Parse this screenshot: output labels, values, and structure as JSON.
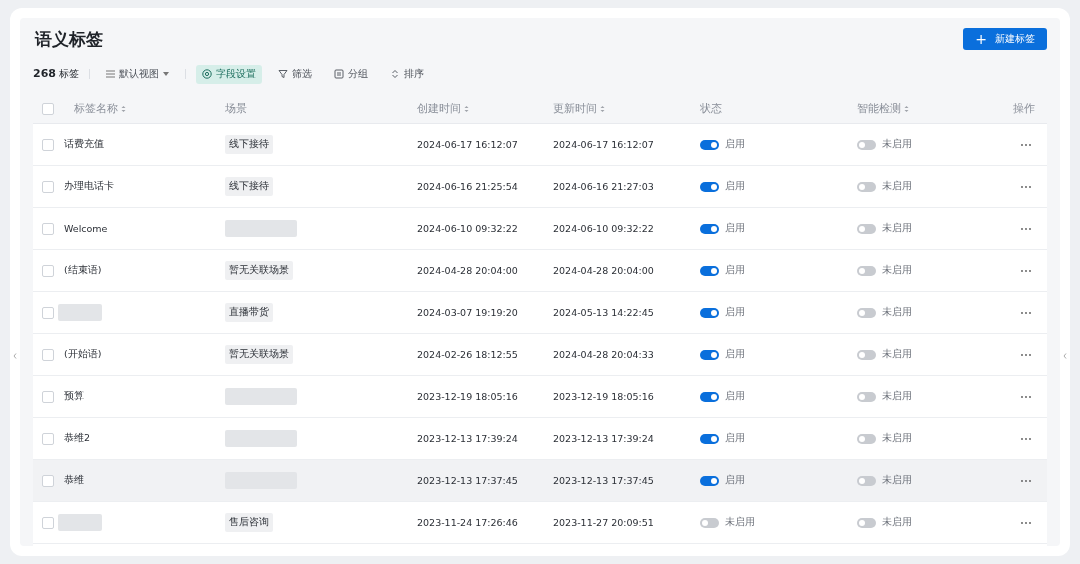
{
  "title": "语义标签",
  "new_button": {
    "icon": "+",
    "label": "新建标签"
  },
  "toolbar": {
    "count": "268",
    "count_unit": "标签",
    "view": "默认视图",
    "actions": [
      {
        "label": "字段设置",
        "selected": true
      },
      {
        "label": "筛选",
        "selected": false
      },
      {
        "label": "分组",
        "selected": false
      },
      {
        "label": "排序",
        "selected": false
      }
    ]
  },
  "table": {
    "select_all_checked": false,
    "columns": [
      {
        "label": "标签名称",
        "sortable": true
      },
      {
        "label": "场景",
        "sortable": false
      },
      {
        "label": "创建时间",
        "sortable": true
      },
      {
        "label": "更新时间",
        "sortable": true
      },
      {
        "label": "状态",
        "sortable": false
      },
      {
        "label": "智能检测",
        "sortable": true
      },
      {
        "label": "操作",
        "sortable": false
      }
    ],
    "rows": [
      {
        "name": {
          "kind": "text",
          "text": "话费充值"
        },
        "scene": {
          "kind": "tag",
          "text": "线下接待"
        },
        "created": "2024-06-17 16:12:07",
        "updated": "2024-06-17 16:12:07",
        "status": {
          "on": true,
          "label": "启用"
        },
        "detect": {
          "on": false,
          "label": "未启用"
        },
        "hovered": false
      },
      {
        "name": {
          "kind": "text",
          "text": "办理电话卡"
        },
        "scene": {
          "kind": "tag",
          "text": "线下接待"
        },
        "created": "2024-06-16 21:25:54",
        "updated": "2024-06-16 21:27:03",
        "status": {
          "on": true,
          "label": "启用"
        },
        "detect": {
          "on": false,
          "label": "未启用"
        },
        "hovered": false
      },
      {
        "name": {
          "kind": "text",
          "text": "Welcome"
        },
        "scene": {
          "kind": "blank"
        },
        "created": "2024-06-10 09:32:22",
        "updated": "2024-06-10 09:32:22",
        "status": {
          "on": true,
          "label": "启用"
        },
        "detect": {
          "on": false,
          "label": "未启用"
        },
        "hovered": false
      },
      {
        "name": {
          "kind": "text",
          "text": "(结束语)"
        },
        "scene": {
          "kind": "tag",
          "text": "暂无关联场景"
        },
        "created": "2024-04-28 20:04:00",
        "updated": "2024-04-28 20:04:00",
        "status": {
          "on": true,
          "label": "启用"
        },
        "detect": {
          "on": false,
          "label": "未启用"
        },
        "hovered": false
      },
      {
        "name": {
          "kind": "blank"
        },
        "scene": {
          "kind": "tag",
          "text": "直播带货"
        },
        "created": "2024-03-07 19:19:20",
        "updated": "2024-05-13 14:22:45",
        "status": {
          "on": true,
          "label": "启用"
        },
        "detect": {
          "on": false,
          "label": "未启用"
        },
        "hovered": false
      },
      {
        "name": {
          "kind": "text",
          "text": "(开始语)"
        },
        "scene": {
          "kind": "tag",
          "text": "暂无关联场景"
        },
        "created": "2024-02-26 18:12:55",
        "updated": "2024-04-28 20:04:33",
        "status": {
          "on": true,
          "label": "启用"
        },
        "detect": {
          "on": false,
          "label": "未启用"
        },
        "hovered": false
      },
      {
        "name": {
          "kind": "text",
          "text": "预算"
        },
        "scene": {
          "kind": "blank"
        },
        "created": "2023-12-19 18:05:16",
        "updated": "2023-12-19 18:05:16",
        "status": {
          "on": true,
          "label": "启用"
        },
        "detect": {
          "on": false,
          "label": "未启用"
        },
        "hovered": false
      },
      {
        "name": {
          "kind": "text",
          "text": "恭维2"
        },
        "scene": {
          "kind": "blank"
        },
        "created": "2023-12-13 17:39:24",
        "updated": "2023-12-13 17:39:24",
        "status": {
          "on": true,
          "label": "启用"
        },
        "detect": {
          "on": false,
          "label": "未启用"
        },
        "hovered": false
      },
      {
        "name": {
          "kind": "text",
          "text": "恭维"
        },
        "scene": {
          "kind": "blank"
        },
        "created": "2023-12-13 17:37:45",
        "updated": "2023-12-13 17:37:45",
        "status": {
          "on": true,
          "label": "启用"
        },
        "detect": {
          "on": false,
          "label": "未启用"
        },
        "hovered": true
      },
      {
        "name": {
          "kind": "blank"
        },
        "scene": {
          "kind": "tag",
          "text": "售后咨询"
        },
        "created": "2023-11-24 17:26:46",
        "updated": "2023-11-27 20:09:51",
        "status": {
          "on": false,
          "label": "未启用"
        },
        "detect": {
          "on": false,
          "label": "未启用"
        },
        "hovered": false
      }
    ]
  }
}
